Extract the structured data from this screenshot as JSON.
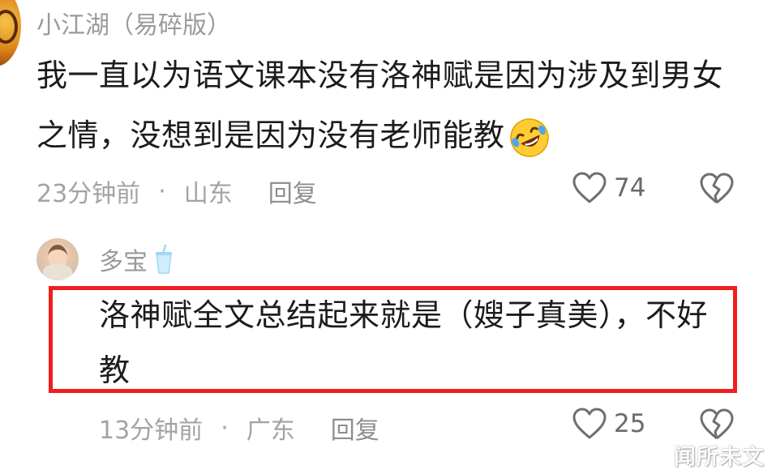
{
  "comment_1": {
    "author": "小江湖（易碎版）",
    "text": "我一直以为语文课本没有洛神赋是因为涉及到男女之情，没想到是因为没有老师能教",
    "emoji": "rolling-on-floor-laughing-emoji",
    "time": "23分钟前",
    "separator": "·",
    "location": "山东",
    "reply_label": "回复",
    "like_count": "74"
  },
  "comment_2": {
    "author": "多宝",
    "author_badge_icon": "drink-cup-icon",
    "text": "洛神赋全文总结起来就是（嫂子真美），不好教",
    "highlight_color": "#ef1f1f",
    "time": "13分钟前",
    "separator": "·",
    "location": "广东",
    "reply_label": "回复",
    "like_count": "25"
  },
  "watermark": "闻所未文"
}
